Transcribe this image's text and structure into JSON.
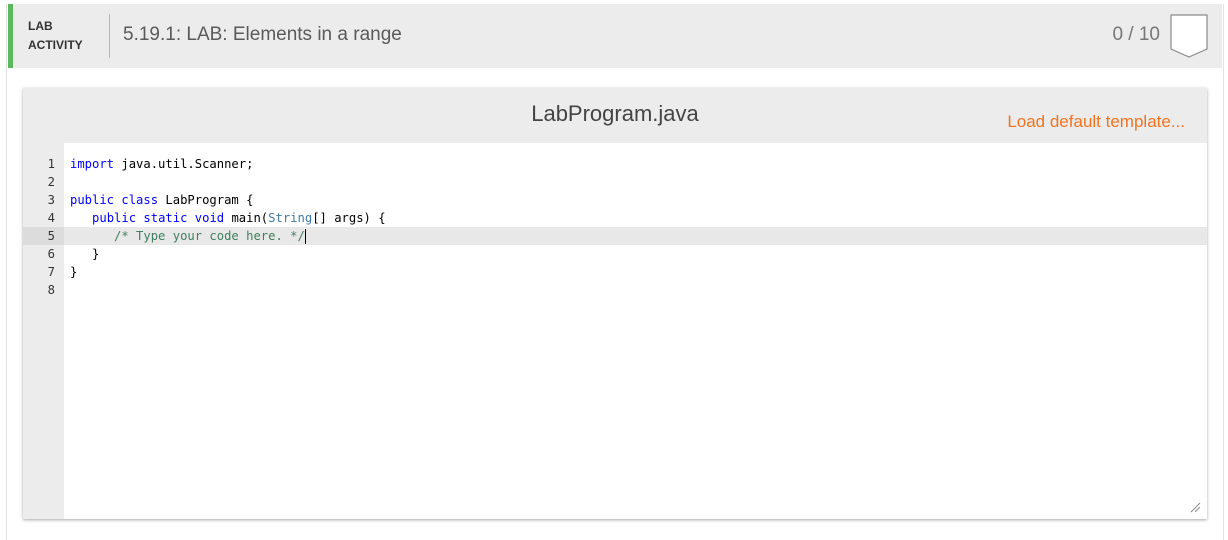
{
  "header": {
    "tag_line1": "LAB",
    "tag_line2": "ACTIVITY",
    "title": "5.19.1: LAB: Elements in a range",
    "score": "0 / 10"
  },
  "editor": {
    "file_name": "LabProgram.java",
    "load_template_label": "Load default template...",
    "line_numbers": [
      "1",
      "2",
      "3",
      "4",
      "5",
      "6",
      "7",
      "8"
    ],
    "code": {
      "l1_kw": "import",
      "l1_rest": " java.util.Scanner;",
      "l3_kw1": "public",
      "l3_kw2": "class",
      "l3_rest": " LabProgram {",
      "l4_indent": "   ",
      "l4_kw1": "public",
      "l4_kw2": "static",
      "l4_kw3": "void",
      "l4_mid": " main(",
      "l4_type": "String",
      "l4_rest": "[] args) {",
      "l5_indent": "      ",
      "l5_comment": "/* Type your code here. */",
      "l6": "   }",
      "l7": "}"
    }
  },
  "colors": {
    "accent_green": "#5cb85c",
    "link_orange": "#f37321",
    "keyword_blue": "#0000ff",
    "comment_green": "#3f7f5f"
  },
  "icons": {
    "score_badge": "score-badge-icon",
    "resize": "resize-grip-icon"
  }
}
